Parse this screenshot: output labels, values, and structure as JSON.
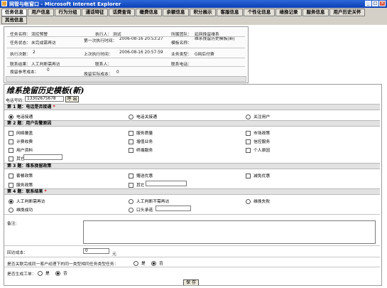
{
  "window": {
    "title": "网管与帐窗口 - Microsoft Internet Explorer"
  },
  "tabs": [
    "任务信息",
    "用户信息",
    "行为分组",
    "通话特征",
    "话费查询",
    "缴费信息",
    "余额信息",
    "积分展示",
    "客服信息",
    "个性化信息",
    "维挽记录",
    "服务信息",
    "用户历史关怀",
    "其他信息"
  ],
  "info": {
    "task_name_label": "任务名称：",
    "task_name": "流控预警",
    "executor_label": "执行人：",
    "executor": "测试",
    "team_label": "所属团队：",
    "team": "延网挽留维系",
    "task_status_label": "任务状态：",
    "task_status": "未完成需再访",
    "first_exec_label": "第一次执行时间：",
    "first_exec": "2006-08-16 20:53:27",
    "template_label": "模板名称：",
    "template": "维系挽留历史模板(新)",
    "exec_count_label": "执行次数：",
    "exec_count": "2",
    "last_exec_label": "上次执行时间：",
    "last_exec": "2006-08-16 20:57:59",
    "biz_type_label": "业务类型：",
    "biz_type": "G网后付费",
    "contact_result_label": "联系结果：",
    "contact_result": "人工判断需再访",
    "contact_person_label": "联系人：",
    "contact_person": "",
    "contact_phone_label": "联系电话：",
    "contact_phone": "",
    "retain_cost_label": "挽留参考成本：",
    "retain_cost": "0",
    "retain_real_cost_label": "挽留实际成本：",
    "retain_real_cost": "0"
  },
  "form": {
    "title": "维系挽留历史模板(新)",
    "phone_label": "电话号码:",
    "phone": "13302675678",
    "call_button": "呼 出",
    "q1": {
      "title": "第 1 题：电话是否接通",
      "required_mark": "*",
      "options": [
        "电话接通",
        "电话关接通",
        "关注用户"
      ],
      "selected": 0
    },
    "q2": {
      "title": "第 2 题：用户告警原因",
      "options": [
        "网络覆盖",
        "服务质量",
        "市场政策",
        "计费收费",
        "增值业务",
        "信控服务",
        "用户资料",
        "终端服务",
        "个人原因",
        "其它"
      ],
      "other_value": ""
    },
    "q3": {
      "title": "第 3 题：维系挽留政策",
      "options": [
        "套餐政策",
        "赠送优惠",
        "减免优惠",
        "服务政策",
        "其它"
      ],
      "other_value": ""
    },
    "q4": {
      "title": "第 4 题：联系结果",
      "required_mark": "*",
      "options": [
        "人工判断需再访",
        "人工判断不需再访",
        "维挽失败",
        "维挽成功",
        "口头承诺"
      ],
      "selected": 0,
      "promise_value": ""
    },
    "remark_label": "备注:",
    "cost_label": "回访成本：",
    "cost_value": "0",
    "cost_unit": "元",
    "q_same_task": "是否关联完成同一客户经理下的同一类型相同任务类型任务：",
    "q_gen_ticket": "是否生成工单：",
    "yes": "是",
    "no": "否",
    "save_button": "保 存"
  }
}
